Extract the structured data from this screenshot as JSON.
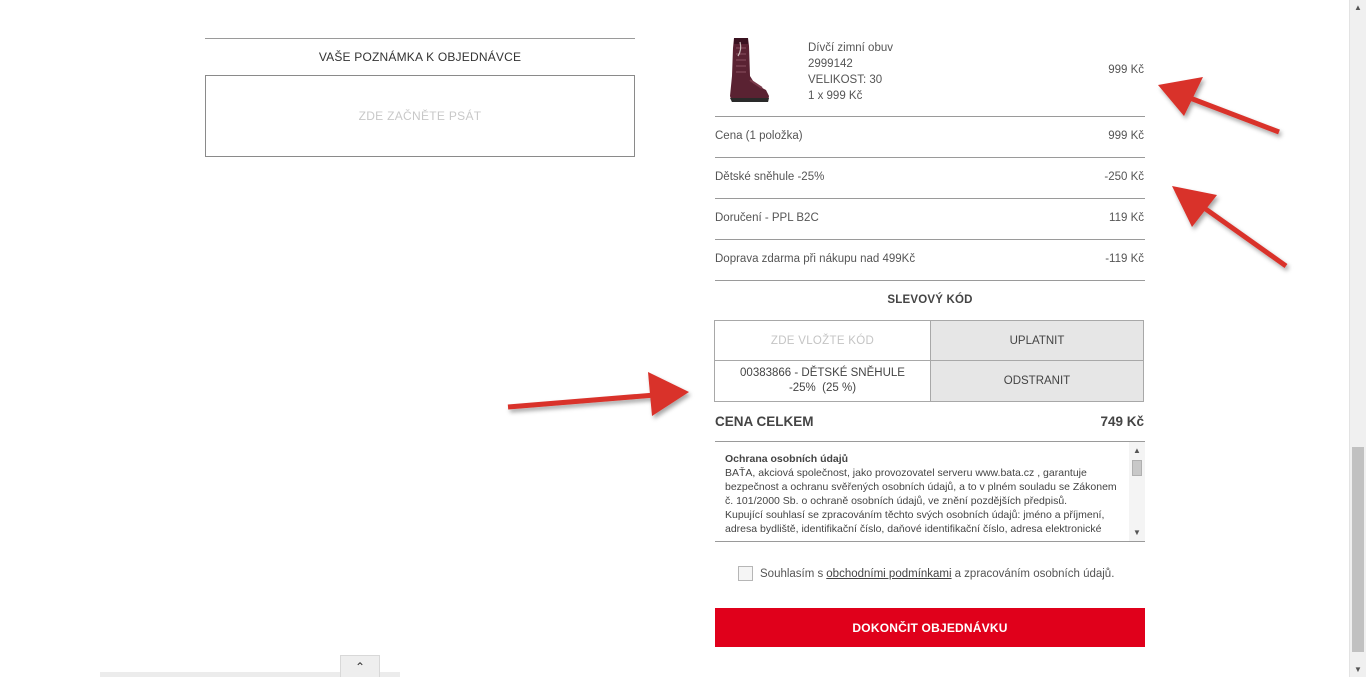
{
  "note": {
    "title": "VAŠE POZNÁMKA K OBJEDNÁVCE",
    "placeholder": "ZDE ZAČNĚTE PSÁT"
  },
  "product": {
    "name": "Dívčí zimní obuv",
    "code": "2999142",
    "size": "VELIKOST: 30",
    "qty": "1 x 999 Kč",
    "price": "999 Kč",
    "image_icon": "winter-boot-icon"
  },
  "summary": {
    "rows": [
      {
        "label": "Cena (1 položka)",
        "value": "999 Kč"
      },
      {
        "label": "Dětské sněhule -25%",
        "value": "-250 Kč"
      },
      {
        "label": "Doručení - PPL B2C",
        "value": "119 Kč"
      },
      {
        "label": "Doprava zdarma při nákupu nad 499Kč",
        "value": "-119 Kč"
      }
    ]
  },
  "coupon": {
    "title": "SLEVOVÝ KÓD",
    "placeholder": "ZDE VLOŽTE KÓD",
    "apply_label": "UPLATNIT",
    "applied_code_line1": "00383866 - DĚTSKÉ SNĚHULE",
    "applied_code_line2": "-25%  (25 %)",
    "remove_label": "ODSTRANIT"
  },
  "total": {
    "label": "CENA CELKEM",
    "value": "749 Kč"
  },
  "privacy": {
    "heading": "Ochrana osobních údajů",
    "paragraph1": "BAŤA, akciová společnost, jako provozovatel serveru www.bata.cz , garantuje bezpečnost a ochranu svěřených osobních údajů, a to v plném souladu se Zákonem č. 101/2000 Sb. o ochraně osobních údajů, ve znění pozdějších předpisů.",
    "paragraph2": "Kupující souhlasí se zpracováním těchto svých osobních údajů: jméno a příjmení, adresa bydliště, identifikační číslo, daňové identifikační číslo, adresa elektronické"
  },
  "agree": {
    "prefix": "Souhlasím s",
    "link": "obchodními podmínkami",
    "suffix": "a zpracováním osobních údajů."
  },
  "submit_label": "DOKONČIT OBJEDNÁVKU",
  "colors": {
    "accent": "#e0001b",
    "annotation_arrow": "#d9312b",
    "button_grey": "#e6e6e6"
  }
}
